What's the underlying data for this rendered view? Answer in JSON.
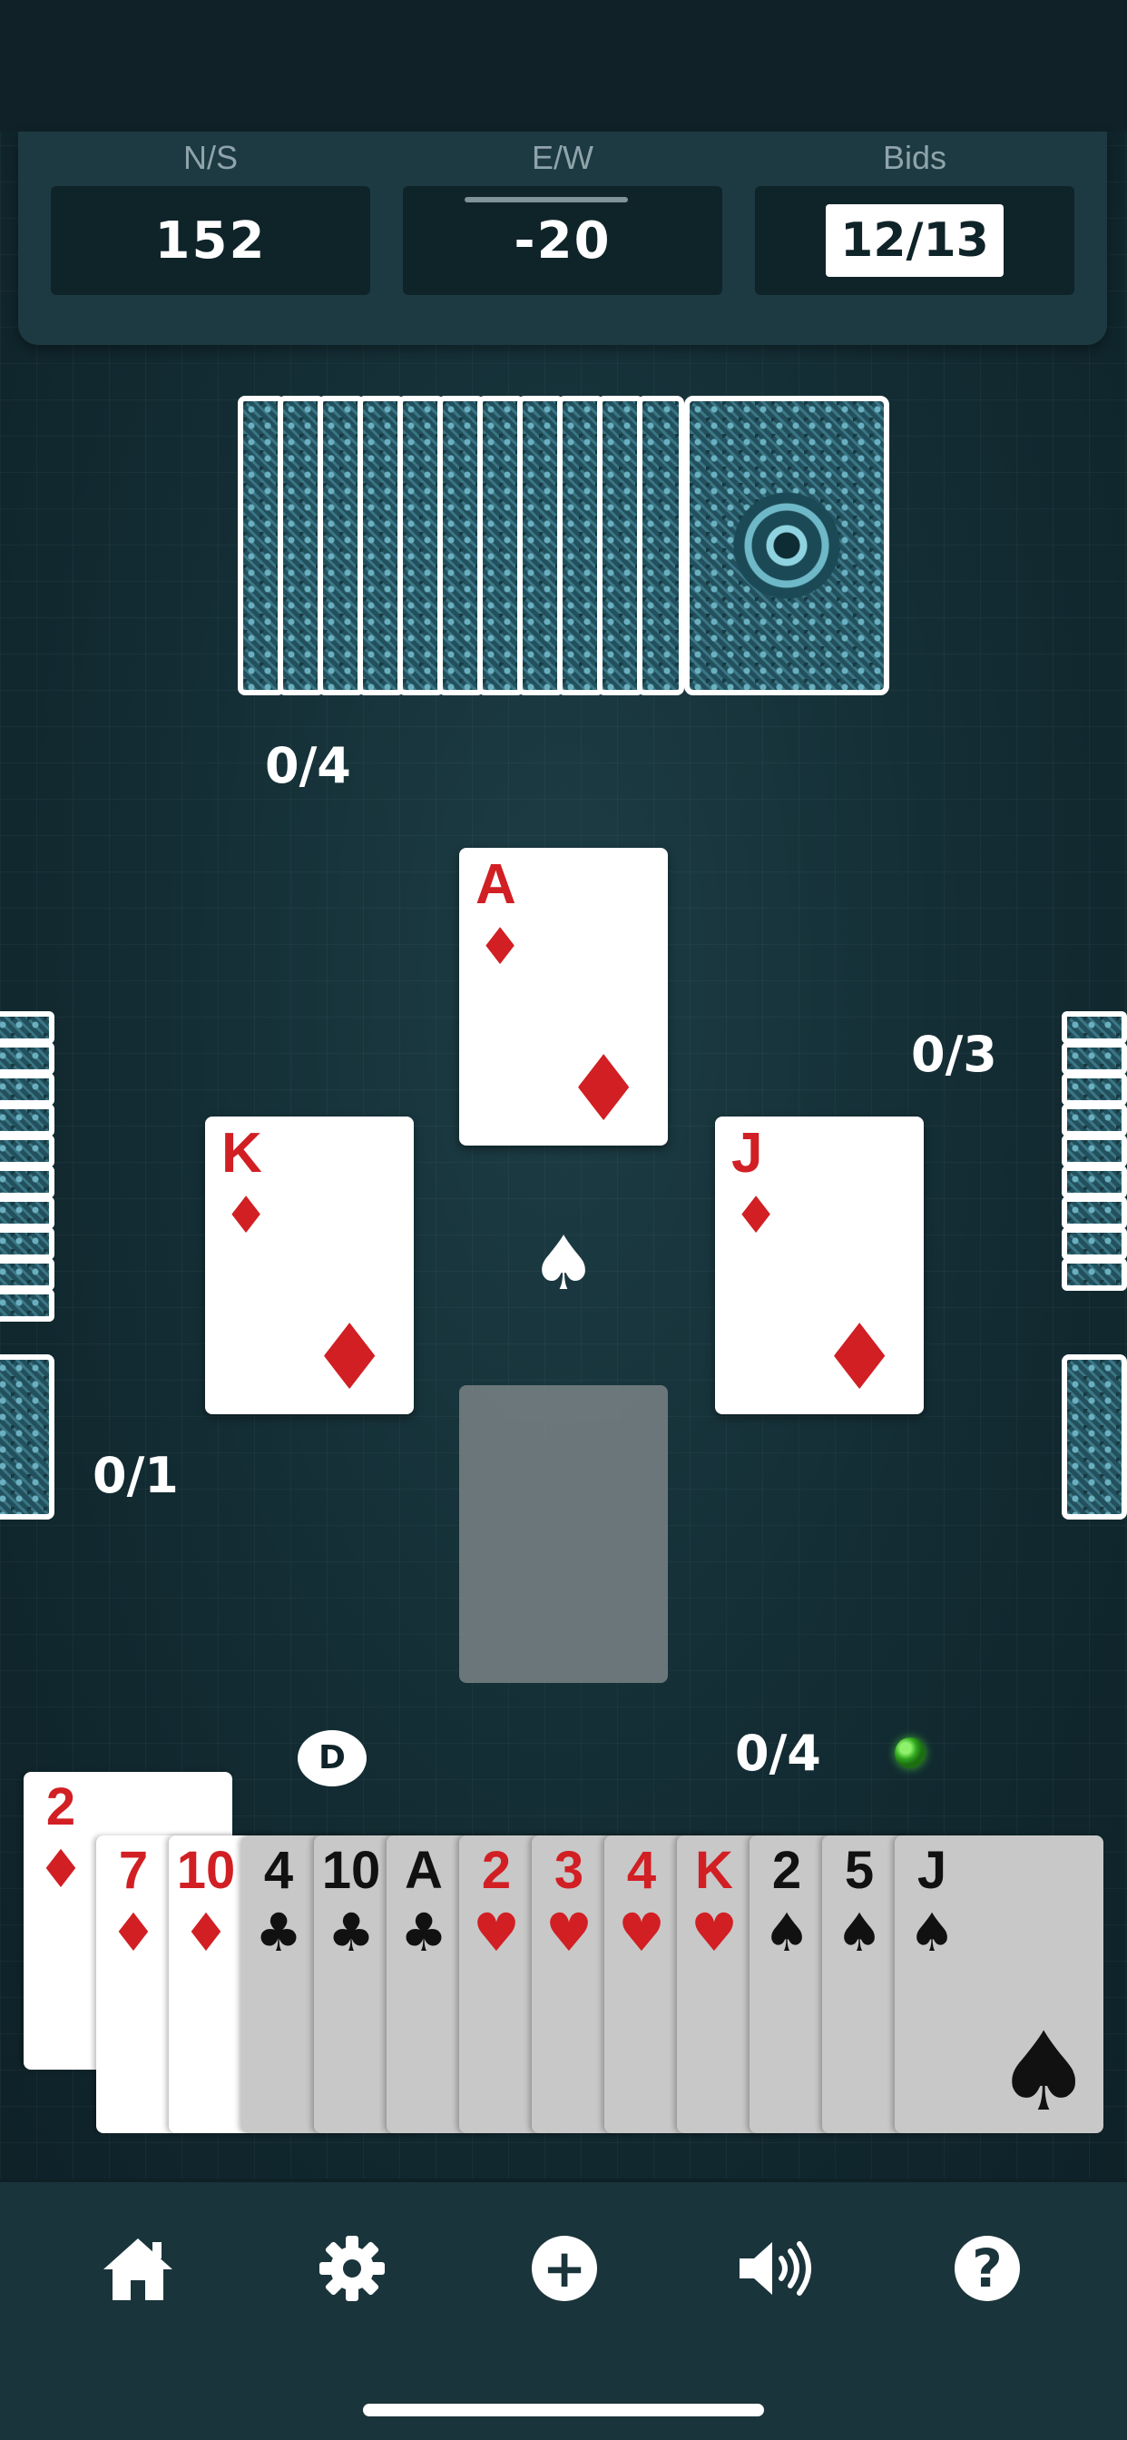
{
  "scoreboard": {
    "ns_label": "N/S",
    "ns_score": "152",
    "ew_label": "E/W",
    "ew_score": "-20",
    "bids_label": "Bids",
    "bids_value": "12/13"
  },
  "tricks": {
    "north": "0/4",
    "east": "0/3",
    "west": "0/1",
    "south": "0/4"
  },
  "played_cards": {
    "north": {
      "rank": "A",
      "suit": "♦"
    },
    "west": {
      "rank": "K",
      "suit": "♦"
    },
    "east": {
      "rank": "J",
      "suit": "♦"
    }
  },
  "trump_suit": "♠",
  "dealer_label": "D",
  "hand": [
    {
      "rank": "2",
      "suit": "♦",
      "color": "red"
    },
    {
      "rank": "7",
      "suit": "♦",
      "color": "red"
    },
    {
      "rank": "10",
      "suit": "♦",
      "color": "red"
    },
    {
      "rank": "4",
      "suit": "♣",
      "color": "black"
    },
    {
      "rank": "10",
      "suit": "♣",
      "color": "black"
    },
    {
      "rank": "A",
      "suit": "♣",
      "color": "black"
    },
    {
      "rank": "2",
      "suit": "♥",
      "color": "red"
    },
    {
      "rank": "3",
      "suit": "♥",
      "color": "red"
    },
    {
      "rank": "4",
      "suit": "♥",
      "color": "red"
    },
    {
      "rank": "K",
      "suit": "♥",
      "color": "red"
    },
    {
      "rank": "2",
      "suit": "♠",
      "color": "black"
    },
    {
      "rank": "5",
      "suit": "♠",
      "color": "black"
    },
    {
      "rank": "J",
      "suit": "♠",
      "color": "black"
    }
  ],
  "bottom_nav": [
    "home-icon",
    "settings-gear-icon",
    "add-icon",
    "sound-icon",
    "help-icon"
  ],
  "colors": {
    "table": "#163037",
    "panel": "#1d3a42",
    "card_red": "#d11f24"
  }
}
